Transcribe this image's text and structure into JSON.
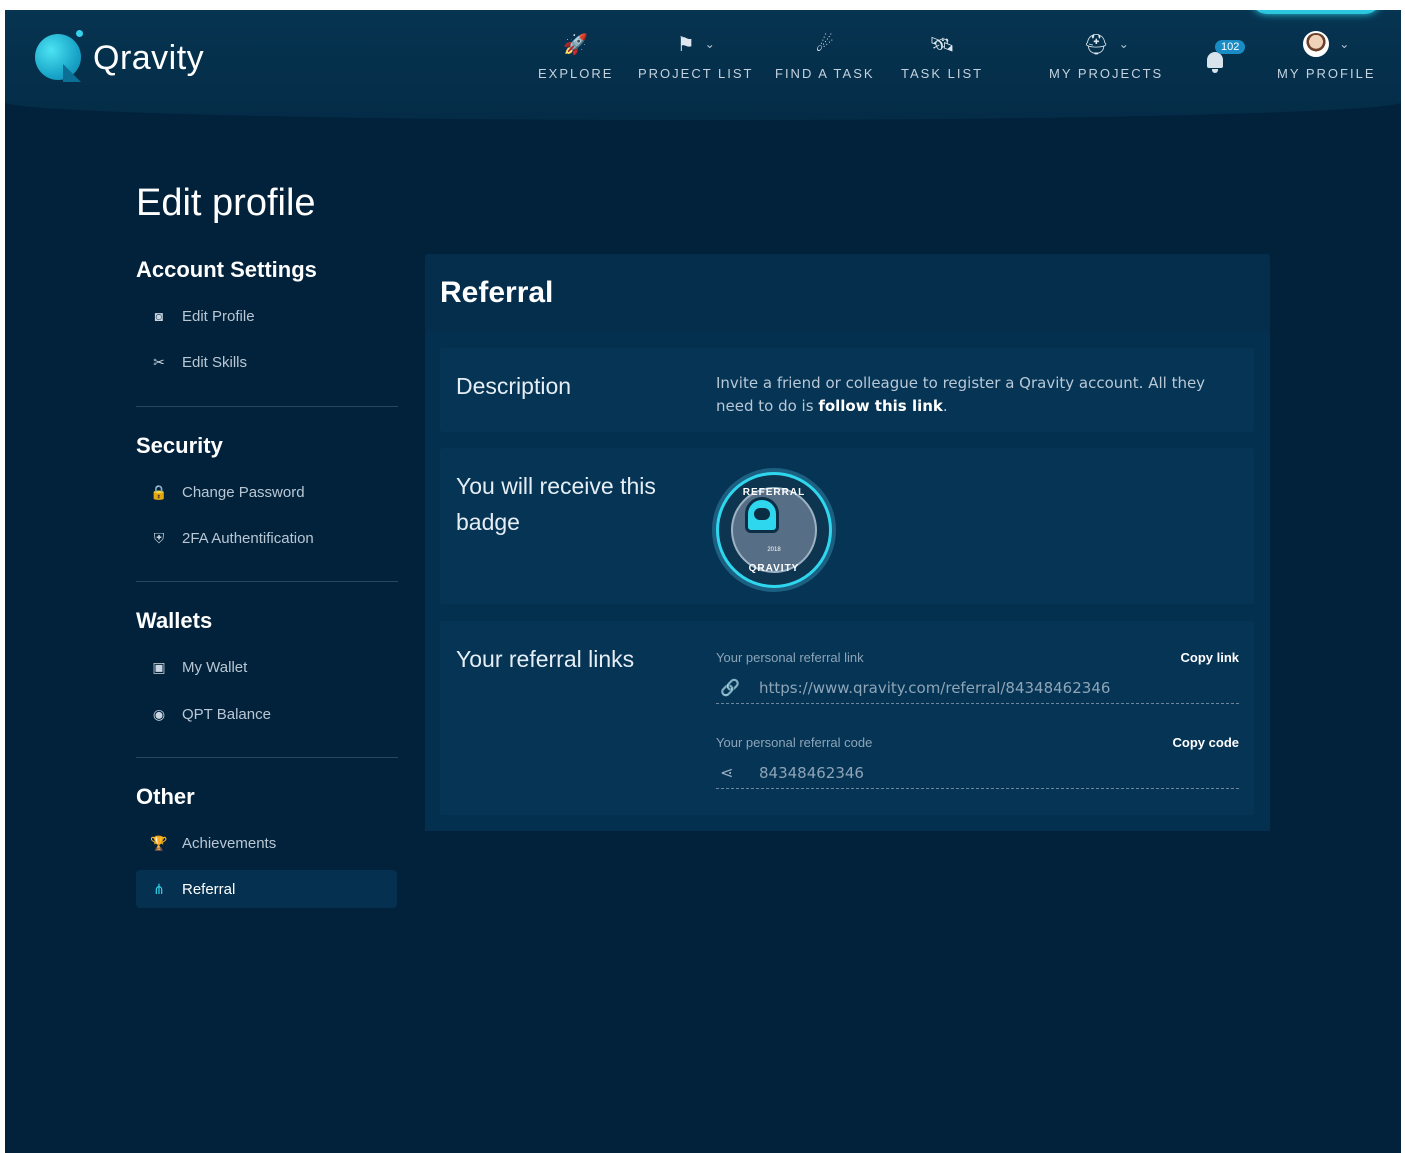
{
  "app": {
    "logo_text": "Qravity"
  },
  "nav": {
    "items": [
      {
        "label": "EXPLORE",
        "icon": "rocket-icon"
      },
      {
        "label": "PROJECT LIST",
        "icon": "flag-icon"
      },
      {
        "label": "FIND A TASK",
        "icon": "meteor-icon"
      },
      {
        "label": "TASK LIST",
        "icon": "satellite-icon"
      },
      {
        "label": "MY PROJECTS",
        "icon": "astronaut-icon"
      }
    ],
    "notifications_count": "102",
    "profile_label": "MY PROFILE"
  },
  "page": {
    "title": "Edit profile"
  },
  "sidebar": {
    "sections": [
      {
        "heading": "Account Settings",
        "items": [
          {
            "label": "Edit Profile"
          },
          {
            "label": "Edit Skills"
          }
        ]
      },
      {
        "heading": "Security",
        "items": [
          {
            "label": "Change Password"
          },
          {
            "label": "2FA Authentification"
          }
        ]
      },
      {
        "heading": "Wallets",
        "items": [
          {
            "label": "My Wallet"
          },
          {
            "label": "QPT Balance"
          }
        ]
      },
      {
        "heading": "Other",
        "items": [
          {
            "label": "Achievements"
          },
          {
            "label": "Referral"
          }
        ]
      }
    ],
    "active": "Referral"
  },
  "referral": {
    "title": "Referral",
    "description_label": "Description",
    "description_text": "Invite a friend or colleague to register a Qravity account. All they need to do is",
    "description_link": "follow this link",
    "description_end": ".",
    "badge_label": "You will receive this badge",
    "badge": {
      "top_text": "REFERRAL",
      "bottom_text": "QRAVITY",
      "year": "2018"
    },
    "links_label": "Your referral links",
    "link_field": {
      "label": "Your personal referral link",
      "action": "Copy link",
      "value": "https://www.qravity.com/referral/84348462346"
    },
    "code_field": {
      "label": "Your personal referral code",
      "action": "Copy code",
      "value": "84348462346"
    }
  },
  "colors": {
    "background": "#02223b",
    "card": "#042e4c",
    "accent": "#2fd7ee",
    "notification": "#1a8cc5"
  }
}
